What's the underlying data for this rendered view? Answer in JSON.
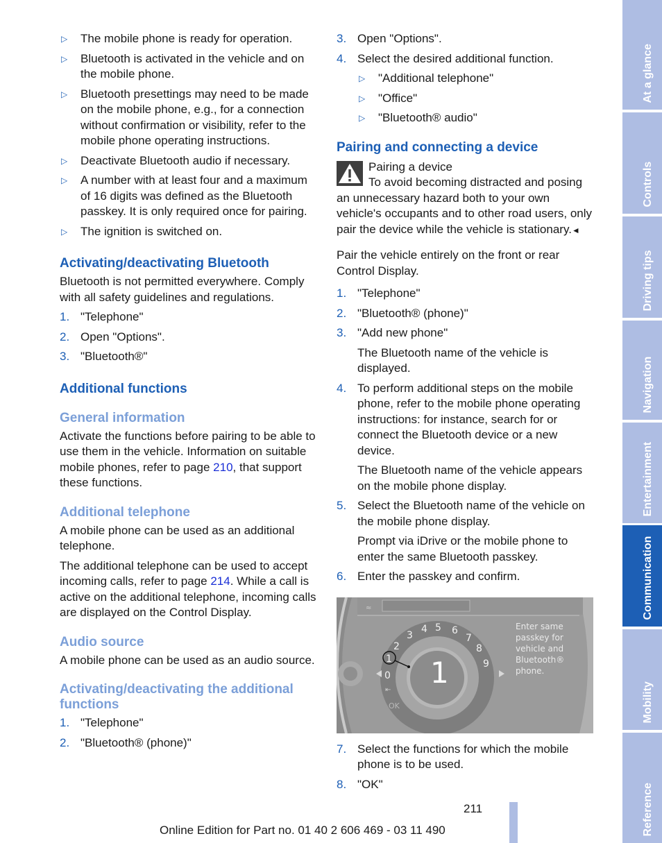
{
  "left": {
    "prereq_bullets": [
      "The mobile phone is ready for operation.",
      "Bluetooth is activated in the vehicle and on the mobile phone.",
      "Bluetooth presettings may need to be made on the mobile phone, e.g., for a connection without confirmation or visibility, refer to the mobile phone operating instructions.",
      "Deactivate Bluetooth audio if necessary.",
      "A number with at least four and a maximum of 16 digits was defined as the Bluetooth passkey. It is only required once for pairing.",
      "The ignition is switched on."
    ],
    "bullet_glyph": "▷",
    "activating_heading": "Activating/deactivating Bluetooth",
    "activating_text": "Bluetooth is not permitted everywhere. Comply with all safety guidelines and regulations.",
    "activating_steps": [
      {
        "num": "1.",
        "text": "\"Telephone\""
      },
      {
        "num": "2.",
        "text": "Open \"Options\"."
      },
      {
        "num": "3.",
        "text": "\"Bluetooth®\""
      }
    ],
    "additional_heading": "Additional functions",
    "general_heading": "General information",
    "general_text_before": "Activate the functions before pairing to be able to use them in the vehicle. Information on suitable mobile phones, refer to page ",
    "general_link": "210",
    "general_text_after": ", that support these functions.",
    "add_tel_heading": "Additional telephone",
    "add_tel_text1": "A mobile phone can be used as an additional telephone.",
    "add_tel_text2_before": "The additional telephone can be used to accept incoming calls, refer to page ",
    "add_tel_link": "214",
    "add_tel_text2_after": ". While a call is active on the additional telephone, incoming calls are displayed on the Control Display.",
    "audio_heading": "Audio source",
    "audio_text": "A mobile phone can be used as an audio source.",
    "act_add_heading": "Activating/deactivating the additional functions",
    "act_add_steps": [
      {
        "num": "1.",
        "text": "\"Telephone\""
      },
      {
        "num": "2.",
        "text": "\"Bluetooth® (phone)\""
      }
    ]
  },
  "right": {
    "cont_steps": [
      {
        "num": "3.",
        "text": "Open \"Options\"."
      },
      {
        "num": "4.",
        "text": "Select the desired additional function."
      }
    ],
    "function_options": [
      "\"Additional telephone\"",
      "\"Office\"",
      "\"Bluetooth® audio\""
    ],
    "pairing_heading": "Pairing and connecting a device",
    "warning_title": "Pairing a device",
    "warning_text": "To avoid becoming distracted and posing an unnecessary hazard both to your own vehicle's occupants and to other road users, only pair the device while the vehicle is stationary.",
    "warning_endmark": "◄",
    "pair_intro": "Pair the vehicle entirely on the front or rear Control Display.",
    "pair_steps": [
      {
        "num": "1.",
        "text": "\"Telephone\"",
        "note": ""
      },
      {
        "num": "2.",
        "text": "\"Bluetooth® (phone)\"",
        "note": ""
      },
      {
        "num": "3.",
        "text": "\"Add new phone\"",
        "note": "The Bluetooth name of the vehicle is displayed."
      },
      {
        "num": "4.",
        "text": "To perform additional steps on the mobile phone, refer to the mobile phone operating instructions: for instance, search for or connect the Bluetooth device or a new device.",
        "note": "The Bluetooth name of the vehicle appears on the mobile phone display."
      },
      {
        "num": "5.",
        "text": "Select the Bluetooth name of the vehicle on the mobile phone display.",
        "note": "Prompt via iDrive or the mobile phone to enter the same Bluetooth passkey."
      },
      {
        "num": "6.",
        "text": "Enter the passkey and confirm.",
        "note": ""
      }
    ],
    "idrive_screen": {
      "hint": "Enter same passkey for vehicle and Bluetooth® phone.",
      "dial_digits": [
        "0",
        "1",
        "2",
        "3",
        "4",
        "5",
        "6",
        "7",
        "8",
        "9"
      ],
      "selected_digit": "1",
      "callout": "1",
      "ok_label": "OK",
      "input_value": "_"
    },
    "final_steps": [
      {
        "num": "7.",
        "text": "Select the functions for which the mobile phone is to be used."
      },
      {
        "num": "8.",
        "text": "\"OK\""
      }
    ]
  },
  "tabs": [
    {
      "label": "At a glance",
      "active": false
    },
    {
      "label": "Controls",
      "active": false
    },
    {
      "label": "Driving tips",
      "active": false
    },
    {
      "label": "Navigation",
      "active": false
    },
    {
      "label": "Entertainment",
      "active": false
    },
    {
      "label": "Communication",
      "active": true
    },
    {
      "label": "Mobility",
      "active": false
    },
    {
      "label": "Reference",
      "active": false
    }
  ],
  "page_number": "211",
  "footer": "Online Edition for Part no. 01 40 2 606 469 - 03 11 490",
  "colors": {
    "heading_primary": "#1d5fb5",
    "heading_secondary": "#7b9fd8",
    "link": "#1a2fd6",
    "tab_inactive": "#aebde3",
    "tab_active": "#1d5fb5"
  }
}
